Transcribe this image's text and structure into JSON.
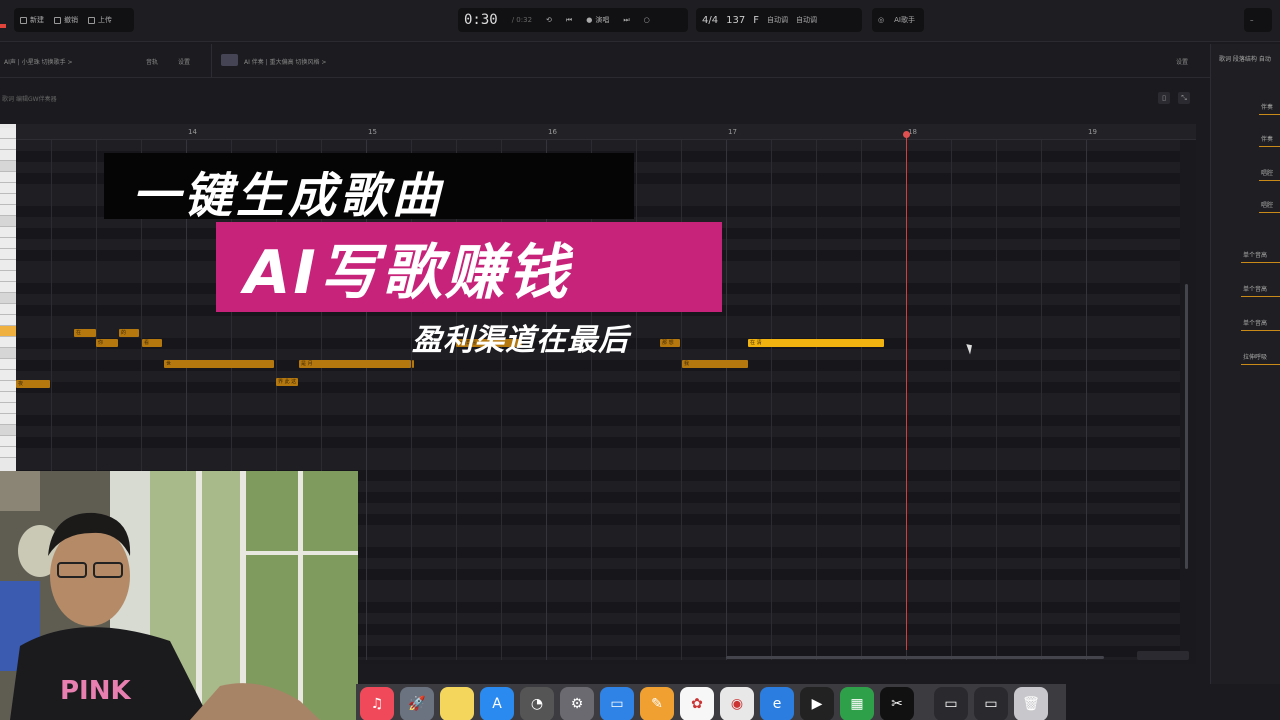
{
  "toolbar": {
    "new_label": "新建",
    "back_label": "撤销",
    "upload_label": "上传",
    "time": "0:30",
    "time_total": "/ 0:32",
    "mode_label": "演唱",
    "time_sig": "4/4",
    "tempo": "137",
    "key": "F",
    "key_detail1": "自动调",
    "key_detail2": "自动调",
    "ai_label": "AI歌手"
  },
  "track_bar": {
    "track_left": "AI声 | 小星珠   切换歌手 >",
    "left_action1": "音轨",
    "left_action2": "设置",
    "track_right": "AI 伴奏 | 重大偏高   切换风格 >",
    "right_action": "设置"
  },
  "row3": {
    "label": "歌词",
    "hint": "编辑GW伴奏器"
  },
  "ruler": {
    "bars": [
      "14",
      "15",
      "16",
      "17",
      "18",
      "19"
    ]
  },
  "notes": [
    {
      "label": "在"
    },
    {
      "label": "你"
    },
    {
      "label": "的"
    },
    {
      "label": "看"
    },
    {
      "label": "世"
    },
    {
      "label": "界  此  这"
    },
    {
      "label": "是  月"
    },
    {
      "label": "一  样  看"
    },
    {
      "label": "那  想"
    },
    {
      "label": "我"
    },
    {
      "label": "在  清"
    },
    {
      "label": "夜"
    },
    {
      "label": "光"
    }
  ],
  "overlay": {
    "line1": "一键生成歌曲",
    "line2": "AI写歌赚钱",
    "line3": "盈利渠道在最后"
  },
  "right_panel": {
    "header": "歌词  段落结构  自动",
    "items": [
      "伴奏",
      "伴奏",
      "唱腔",
      "唱腔",
      "单个音高",
      "单个音高",
      "单个音高",
      "拉伸呼吸"
    ]
  },
  "webcam": {
    "shirt_text": "PINK"
  },
  "dock": {
    "apps": [
      "music-app",
      "launchpad-app",
      "notes-app",
      "app-store",
      "activity-app",
      "system-preferences",
      "keynote-app",
      "pages-app",
      "photos-app",
      "chrome-app",
      "edge-app",
      "final-cut-app",
      "numbers-app",
      "capcut-app",
      "window1",
      "window2",
      "trash"
    ]
  }
}
